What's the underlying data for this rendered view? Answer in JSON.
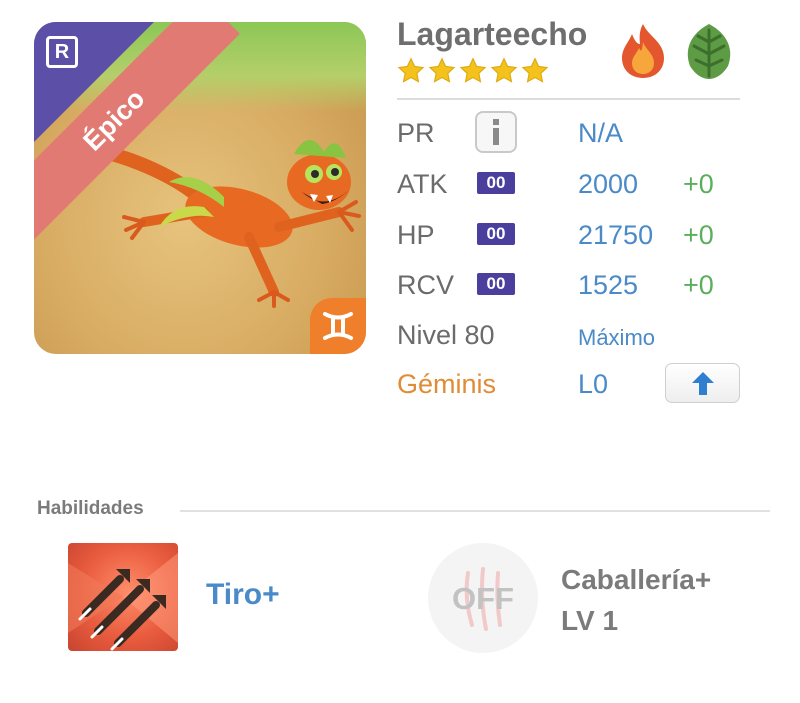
{
  "monster": {
    "name": "Lagarteecho",
    "stars": 5,
    "rarity_label": "Épico",
    "rarity_badge": "R",
    "elements": [
      "fire-element-icon",
      "nature-element-icon"
    ]
  },
  "stats": {
    "pr": {
      "label": "PR",
      "value": "N/A"
    },
    "atk": {
      "label": "ATK",
      "rank": "00",
      "value": "2000",
      "plus": "+0"
    },
    "hp": {
      "label": "HP",
      "rank": "00",
      "value": "21750",
      "plus": "+0"
    },
    "rcv": {
      "label": "RCV",
      "rank": "00",
      "value": "1525",
      "plus": "+0"
    },
    "level": {
      "label": "Nivel 80",
      "value": "Máximo"
    },
    "zodiac": {
      "label": "Géminis",
      "value": "L0"
    }
  },
  "skills": {
    "heading": "Habilidades",
    "primary": {
      "name": "Tiro+"
    },
    "secondary": {
      "state": "OFF",
      "name": "Caballería+",
      "level": "LV 1"
    }
  },
  "colors": {
    "accent_blue": "#4a8ac8",
    "plus_green": "#5cae5c",
    "zodiac_orange": "#e18b34",
    "rank_purple": "#4b3f9e",
    "star_yellow": "#f3c21c"
  }
}
